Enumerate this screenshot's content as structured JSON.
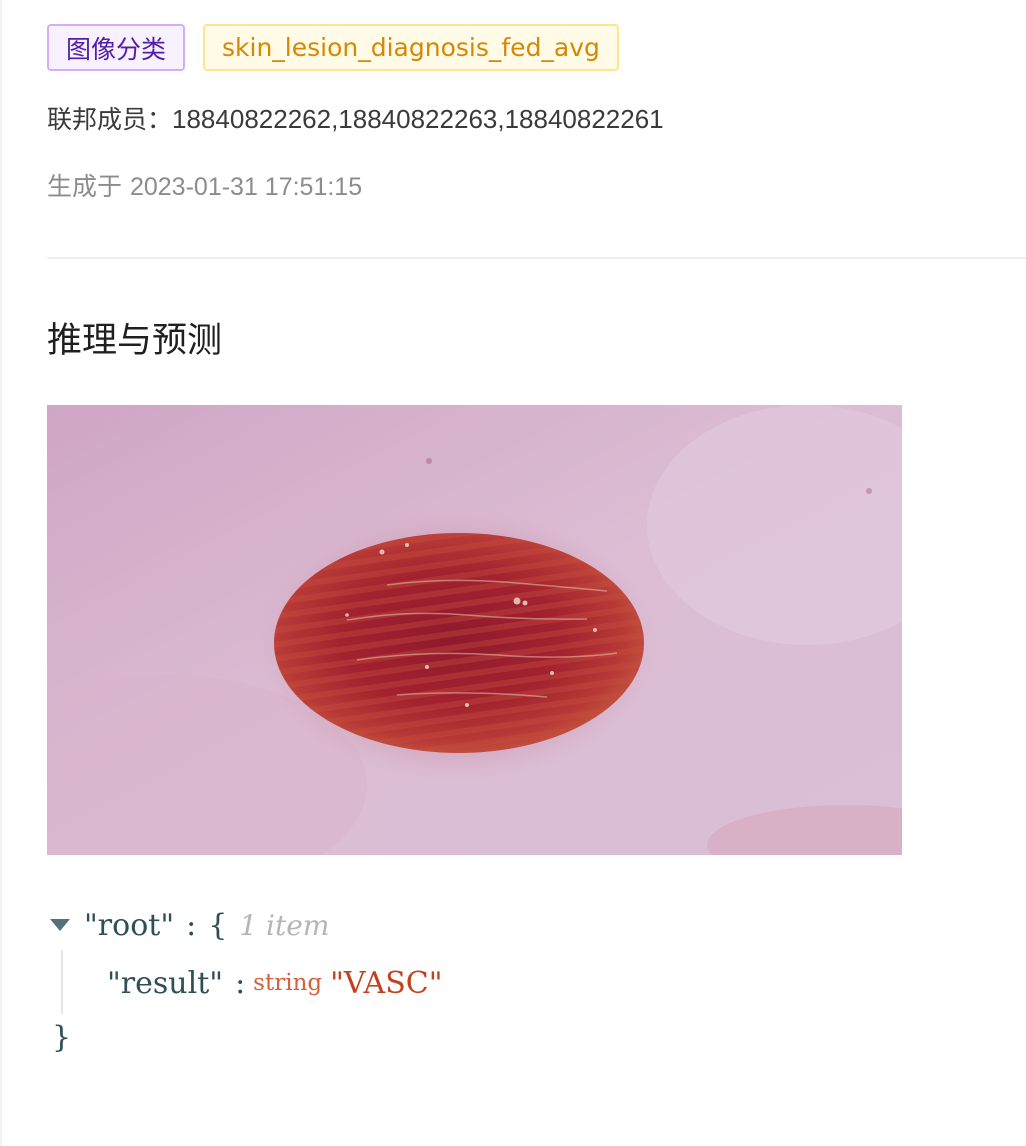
{
  "tags": {
    "category": "图像分类",
    "model_name": "skin_lesion_diagnosis_fed_avg"
  },
  "members": {
    "label": "联邦成员：",
    "value": "18840822262,18840822263,18840822261"
  },
  "generated": {
    "label": "生成于",
    "value": "2023-01-31 17:51:15"
  },
  "section": {
    "title": "推理与预测"
  },
  "json_view": {
    "root_key": "\"root\"",
    "colon": ":",
    "open_brace": "{",
    "item_count": "1 item",
    "result_key": "\"result\"",
    "result_type": "string",
    "result_value": "\"VASC\"",
    "close_brace": "}"
  },
  "colors": {
    "tag_purple_text": "#531dab",
    "tag_gold_text": "#d48806",
    "json_string": "#c2421f"
  },
  "icons": {
    "collapse": "caret-down-icon"
  }
}
